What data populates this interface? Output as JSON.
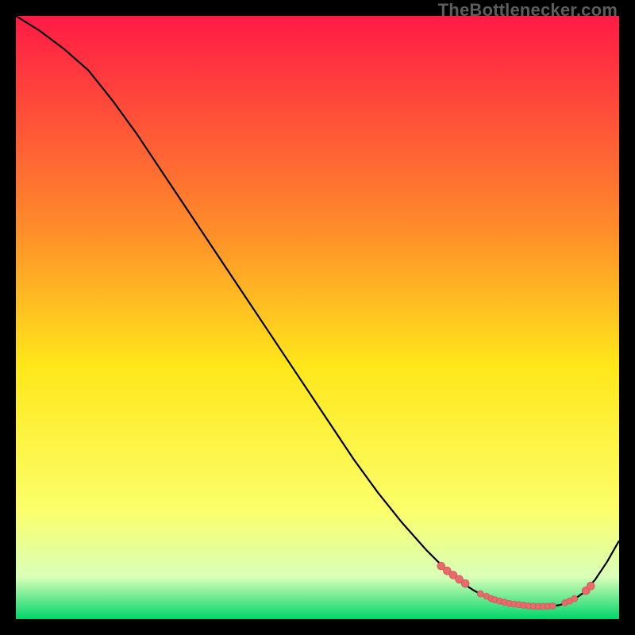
{
  "watermark": "TheBottlenecker.com",
  "colors": {
    "frame": "#000000",
    "gradient_top": "#ff1a46",
    "gradient_mid_upper": "#ff8b2a",
    "gradient_mid": "#ffe71a",
    "gradient_lower": "#fbff6a",
    "gradient_green_top": "#d9ffb8",
    "gradient_green": "#00d56a",
    "curve": "#000000",
    "marker": "#e86a6a",
    "marker_stroke": "#c15555"
  },
  "chart_data": {
    "type": "line",
    "title": "",
    "xlabel": "",
    "ylabel": "",
    "xlim": [
      0,
      100
    ],
    "ylim": [
      0,
      100
    ],
    "series": [
      {
        "name": "bottleneck-curve",
        "x": [
          0,
          4,
          8,
          12,
          16,
          20,
          24,
          28,
          32,
          36,
          40,
          44,
          48,
          52,
          56,
          60,
          64,
          68,
          72,
          74,
          76,
          78,
          80,
          82,
          84,
          86,
          88,
          90,
          92,
          94,
          96,
          98,
          100
        ],
        "y": [
          100,
          97.5,
          94.5,
          91,
          86,
          80.5,
          74.5,
          68.5,
          62.5,
          56.5,
          50.5,
          44.5,
          38.5,
          32.5,
          26.5,
          21,
          16,
          11.5,
          7.5,
          6,
          4.7,
          3.7,
          3,
          2.5,
          2.2,
          2.1,
          2.1,
          2.3,
          2.9,
          4.3,
          6.5,
          9.5,
          13
        ]
      }
    ],
    "markers": {
      "name": "highlight-band",
      "points": [
        {
          "x": 70.5,
          "y": 8.8,
          "r": 5
        },
        {
          "x": 71.5,
          "y": 8.0,
          "r": 5
        },
        {
          "x": 72.5,
          "y": 7.3,
          "r": 5
        },
        {
          "x": 73.5,
          "y": 6.6,
          "r": 5
        },
        {
          "x": 74.5,
          "y": 5.9,
          "r": 5
        },
        {
          "x": 77.0,
          "y": 4.2,
          "r": 4
        },
        {
          "x": 78.0,
          "y": 3.8,
          "r": 4
        },
        {
          "x": 78.8,
          "y": 3.4,
          "r": 4
        },
        {
          "x": 79.4,
          "y": 3.2,
          "r": 4
        },
        {
          "x": 80.2,
          "y": 3.0,
          "r": 4
        },
        {
          "x": 81.0,
          "y": 2.8,
          "r": 4
        },
        {
          "x": 81.8,
          "y": 2.6,
          "r": 4
        },
        {
          "x": 82.6,
          "y": 2.5,
          "r": 4
        },
        {
          "x": 83.4,
          "y": 2.4,
          "r": 4
        },
        {
          "x": 84.2,
          "y": 2.3,
          "r": 4
        },
        {
          "x": 85.0,
          "y": 2.2,
          "r": 4
        },
        {
          "x": 85.8,
          "y": 2.15,
          "r": 4
        },
        {
          "x": 86.6,
          "y": 2.12,
          "r": 4
        },
        {
          "x": 87.4,
          "y": 2.12,
          "r": 4
        },
        {
          "x": 88.2,
          "y": 2.15,
          "r": 4
        },
        {
          "x": 89.0,
          "y": 2.2,
          "r": 4
        },
        {
          "x": 91.0,
          "y": 2.7,
          "r": 4
        },
        {
          "x": 91.8,
          "y": 3.0,
          "r": 4
        },
        {
          "x": 92.6,
          "y": 3.4,
          "r": 4
        },
        {
          "x": 94.5,
          "y": 4.7,
          "r": 5
        },
        {
          "x": 95.3,
          "y": 5.5,
          "r": 5
        }
      ]
    }
  }
}
